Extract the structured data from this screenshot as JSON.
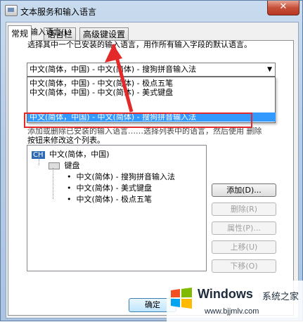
{
  "window": {
    "title": "文本服务和输入语言",
    "close_label": "✕"
  },
  "tabs": [
    {
      "label": "常规"
    },
    {
      "label": "语言栏"
    },
    {
      "label": "高级键设置"
    }
  ],
  "default_lang": {
    "group_label": "默认输入语言(L)",
    "description": "选择其中一个已安装的输入语言，用作所有输入字段的默认语言。",
    "selected": "中文(简体，中国) - 中文(简体) - 搜狗拼音输入法"
  },
  "dropdown": {
    "options": [
      "中文(简体，中国) - 中文(简体) - 极点五笔",
      "中文(简体，中国) - 中文(简体) - 美式键盘",
      "中文(简体，中国) - 中文(简体) - 搜狗拼音输入法"
    ],
    "selected_index": 2
  },
  "installed": {
    "partial_line1": "添加或删除已安装的输入语言……选择列表中的语言，然后使用 删除",
    "partial_line2": "按钮来修改这个列表。",
    "language": "中文(简体，中国)",
    "badge": "CH",
    "category": "键盘",
    "items": [
      "中文(简体) - 搜狗拼音输入法",
      "中文(简体) - 美式键盘",
      "中文(简体) - 极点五笔"
    ]
  },
  "buttons": {
    "add": "添加(D)...",
    "remove": "删除(R)",
    "properties": "属性(P)...",
    "move_up": "上移(U)",
    "move_down": "下移(O)",
    "ok": "确定"
  },
  "watermark": {
    "brand": "Windows",
    "cn": "系统之家",
    "url": "www.bjjmlv.com"
  },
  "colors": {
    "highlight": "#3399ff",
    "annotation": "#e32929"
  }
}
